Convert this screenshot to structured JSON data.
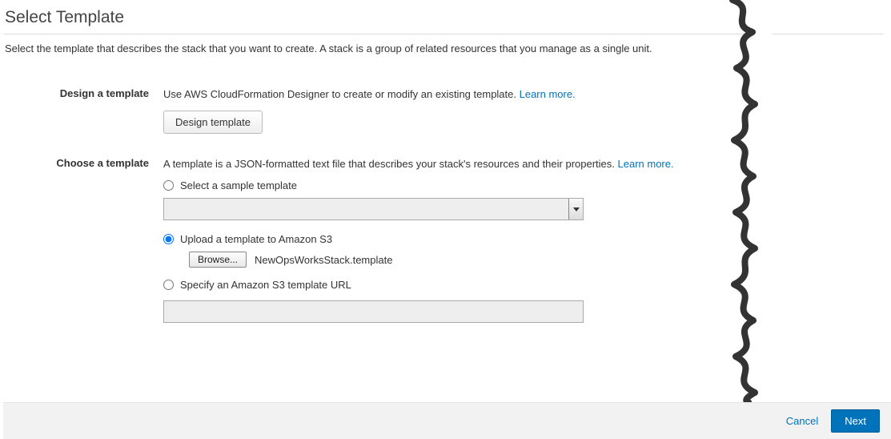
{
  "page": {
    "title": "Select Template",
    "subtitle": "Select the template that describes the stack that you want to create. A stack is a group of related resources that you manage as a single unit."
  },
  "design_section": {
    "label": "Design a template",
    "help": "Use AWS CloudFormation Designer to create or modify an existing template. ",
    "learn_more": "Learn more.",
    "button": "Design template"
  },
  "choose_section": {
    "label": "Choose a template",
    "help": "A template is a JSON-formatted text file that describes your stack's resources and their properties. ",
    "learn_more": "Learn more.",
    "options": {
      "sample": {
        "label": "Select a sample template",
        "selected": false
      },
      "upload": {
        "label": "Upload a template to Amazon S3",
        "selected": true,
        "browse_label": "Browse...",
        "file_name": "NewOpsWorksStack.template"
      },
      "s3url": {
        "label": "Specify an Amazon S3 template URL",
        "selected": false,
        "value": ""
      }
    }
  },
  "footer": {
    "cancel": "Cancel",
    "next": "Next"
  }
}
